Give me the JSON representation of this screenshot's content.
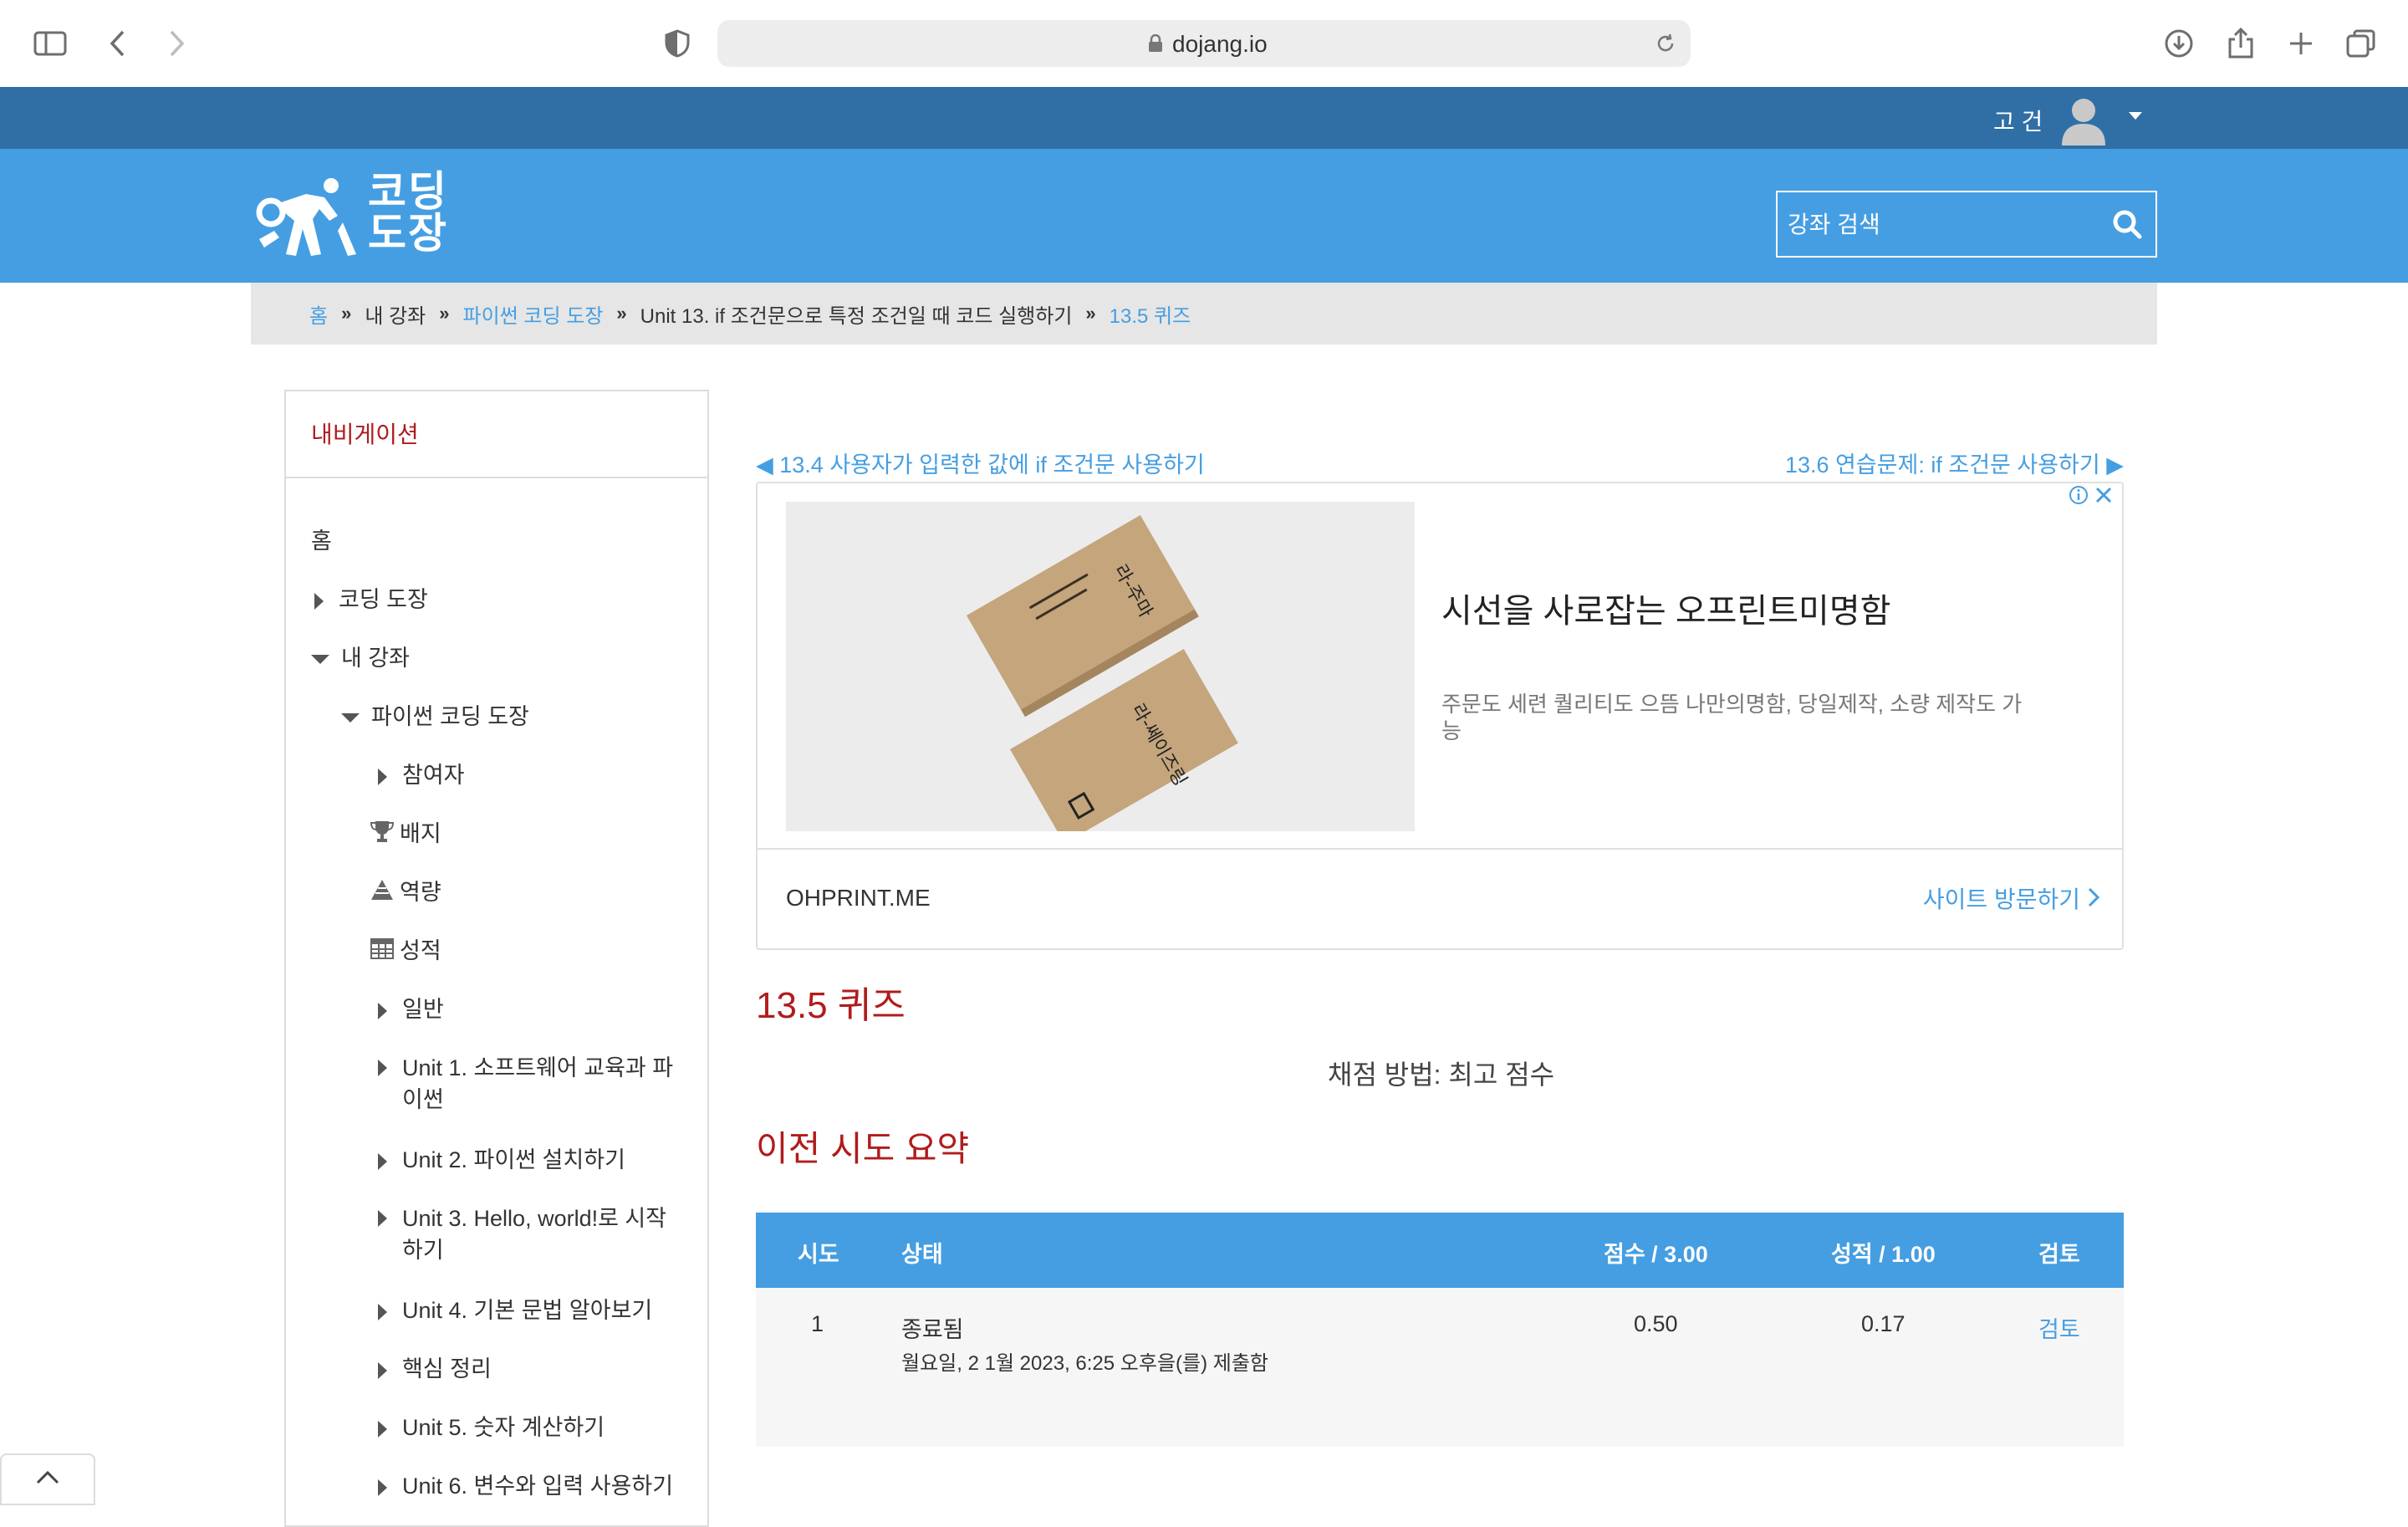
{
  "browser": {
    "url": "dojang.io"
  },
  "user": {
    "name": "고 건"
  },
  "header": {
    "logo_text_line1": "코딩",
    "logo_text_line2": "도장",
    "search_placeholder": "강좌 검색"
  },
  "breadcrumb": [
    {
      "label": "홈",
      "link": true
    },
    {
      "label": "내 강좌",
      "link": false
    },
    {
      "label": "파이썬 코딩 도장",
      "link": true
    },
    {
      "label": "Unit 13. if 조건문으로 특정 조건일 때 코드 실행하기",
      "link": false
    },
    {
      "label": "13.5 퀴즈",
      "link": true
    }
  ],
  "sidebar": {
    "title": "내비게이션",
    "items": [
      {
        "label": "홈"
      },
      {
        "label": "코딩 도장"
      },
      {
        "label": "내 강좌"
      },
      {
        "label": "파이썬 코딩 도장"
      },
      {
        "label": "참여자"
      },
      {
        "label": "배지"
      },
      {
        "label": "역량"
      },
      {
        "label": "성적"
      },
      {
        "label": "일반"
      },
      {
        "label": "Unit 1. 소프트웨어 교육과 파이썬"
      },
      {
        "label": "Unit 2. 파이썬 설치하기"
      },
      {
        "label": "Unit 3. Hello, world!로 시작하기"
      },
      {
        "label": "Unit 4. 기본 문법 알아보기"
      },
      {
        "label": "핵심 정리"
      },
      {
        "label": "Unit 5. 숫자 계산하기"
      },
      {
        "label": "Unit 6. 변수와 입력 사용하기"
      }
    ]
  },
  "nav_links": {
    "prev": "◀ 13.4 사용자가 입력한 값에 if 조건문 사용하기",
    "next": "13.6 연습문제: if 조건문 사용하기 ▶"
  },
  "ad": {
    "headline": "시선을 사로잡는 오프린트미명함",
    "description": "주문도 세련 퀄리티도 으뜸 나만의명함, 당일제작, 소량 제작도 가능",
    "domain": "OHPRINT.ME",
    "cta": "사이트 방문하기",
    "card_text_1": "라-주마",
    "card_text_2": "라-쎄이즈링"
  },
  "quiz": {
    "title": "13.5 퀴즈",
    "grading_method": "채점 방법: 최고 점수",
    "summary_title": "이전 시도 요약"
  },
  "table": {
    "headers": {
      "attempt": "시도",
      "state": "상태",
      "marks": "점수 / 3.00",
      "grade": "성적 / 1.00",
      "review": "검토"
    },
    "rows": [
      {
        "attempt": "1",
        "state": "종료됨",
        "submitted": "월요일, 2 1월 2023, 6:25 오후을(를) 제출함",
        "marks": "0.50",
        "grade": "0.17",
        "review": "검토"
      }
    ]
  },
  "colors": {
    "header_blue": "#459ee2",
    "userbar_blue": "#2f6fa5",
    "accent_red": "#b01c1c"
  }
}
